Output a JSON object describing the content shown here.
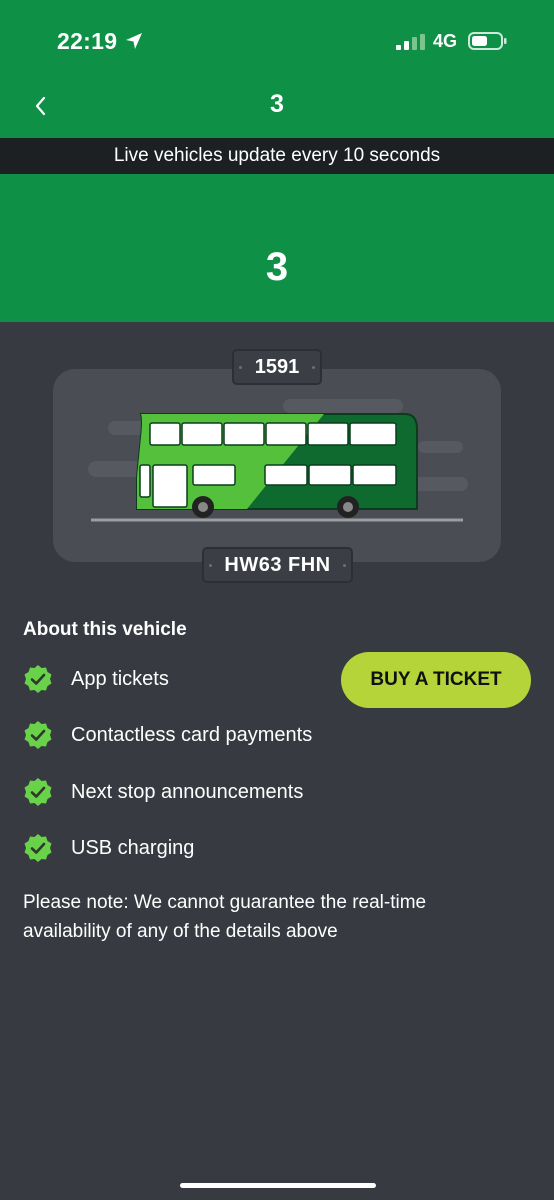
{
  "status_bar": {
    "time": "22:19",
    "network": "4G"
  },
  "header": {
    "title": "3"
  },
  "banner": {
    "text": "Live vehicles update every 10 seconds"
  },
  "route": {
    "number": "3"
  },
  "vehicle": {
    "fleet_number": "1591",
    "registration": "HW63 FHN"
  },
  "about": {
    "heading": "About this vehicle",
    "features": [
      "App tickets",
      "Contactless card payments",
      "Next stop announcements",
      "USB charging"
    ]
  },
  "buy_button": {
    "label": "BUY A TICKET"
  },
  "note": {
    "text": "Please note: We cannot guarantee the real-time availability of any of the details above"
  },
  "colors": {
    "brand_green": "#0e9147",
    "accent_lime": "#b5d43a",
    "background": "#373a40",
    "check_green": "#6ad14a"
  }
}
